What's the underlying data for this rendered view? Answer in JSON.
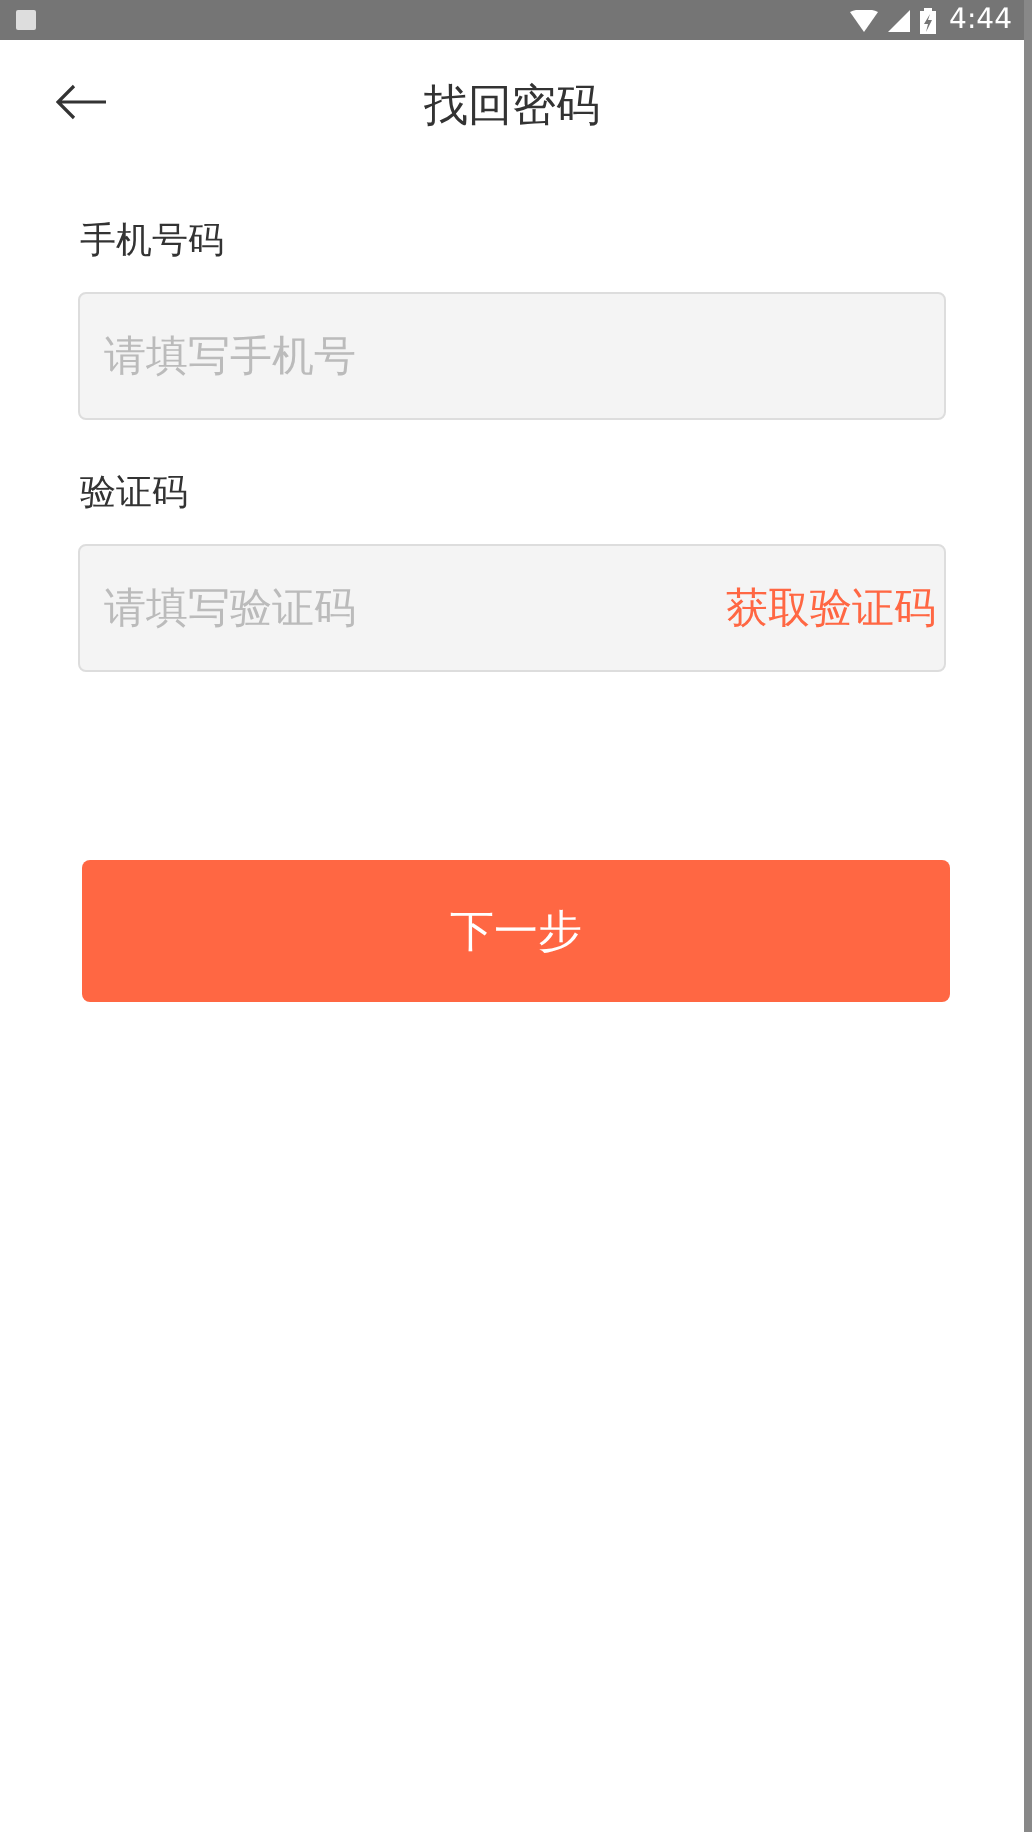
{
  "status_bar": {
    "time": "4:44"
  },
  "header": {
    "title": "找回密码"
  },
  "form": {
    "fields": [
      {
        "label": "手机号码",
        "placeholder": "请填写手机号"
      },
      {
        "label": "验证码",
        "placeholder": "请填写验证码",
        "action": "获取验证码"
      }
    ]
  },
  "submit_button": "下一步"
}
